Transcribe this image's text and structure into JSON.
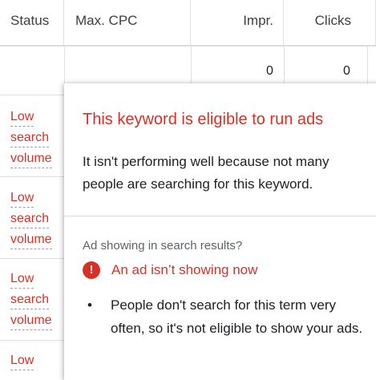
{
  "table": {
    "headers": {
      "status": "Status",
      "max_cpc": "Max. CPC",
      "impr": "Impr.",
      "clicks": "Clicks"
    },
    "total_row": {
      "impr": "0",
      "clicks": "0"
    },
    "rows": [
      {
        "status": [
          "Low",
          "search",
          "volume"
        ]
      },
      {
        "status": [
          "Low",
          "search",
          "volume"
        ]
      },
      {
        "status": [
          "Low",
          "search",
          "volume"
        ]
      },
      {
        "status": [
          "Low"
        ]
      }
    ]
  },
  "popup": {
    "title": "This keyword is eligible to run ads",
    "description": "It isn't performing well because not many people are searching for this keyword.",
    "subheading": "Ad showing in search results?",
    "alert_icon": "!",
    "alert_text": "An ad isn’t showing now",
    "bullet": "People don't search for this term very often, so it's not eligible to show your ads."
  }
}
